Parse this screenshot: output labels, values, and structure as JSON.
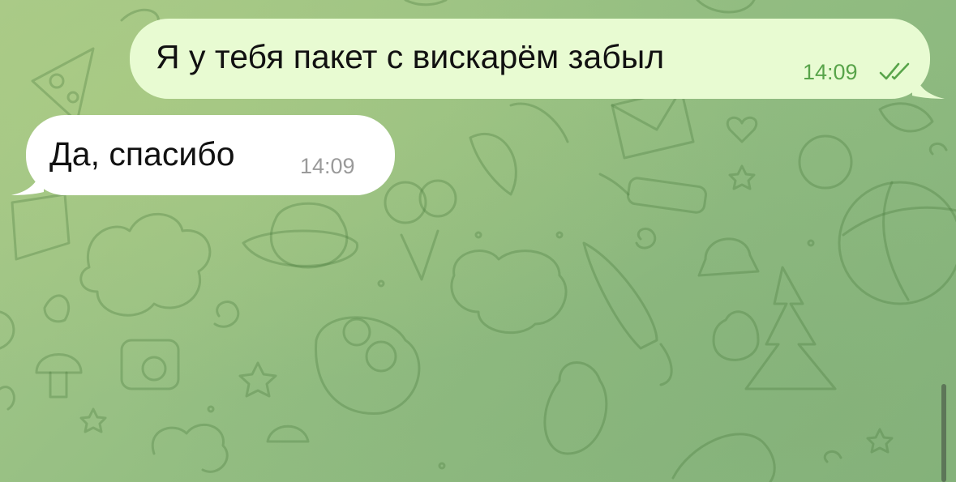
{
  "chat": {
    "messages": [
      {
        "direction": "outgoing",
        "text": "Я у тебя пакет с вискарём забыл",
        "time": "14:09",
        "status": "read",
        "status_icon": "double-check-icon"
      },
      {
        "direction": "incoming",
        "text": "Да, спасибо",
        "time": "14:09"
      }
    ]
  },
  "colors": {
    "wallpaper": "#94be82",
    "outgoing_bubble": "#e8fbd2",
    "incoming_bubble": "#ffffff",
    "outgoing_meta": "#58a44a",
    "incoming_meta": "#9a9a9a",
    "text": "#111111"
  }
}
